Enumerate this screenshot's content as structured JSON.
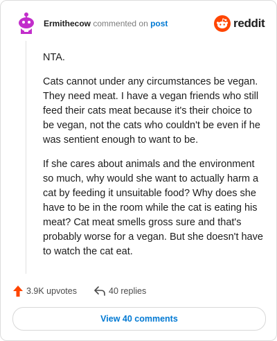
{
  "comment": {
    "username": "Ermithecow",
    "action_text": "commented on",
    "target_link": "post",
    "paragraphs": [
      "NTA.",
      "Cats cannot under any circumstances be vegan. They need meat. I have a vegan friends who still feed their cats meat because it's their choice to be vegan, not the cats who couldn't be even if he was sentient enough to want to be.",
      "If she cares about animals and the environment so much, why would she want to actually harm a cat by feeding it unsuitable food? Why does she have to be in the room while the cat is eating his meat? Cat meat smells gross sure and that's probably worse for a vegan. But she doesn't have to watch the cat eat."
    ]
  },
  "brand": {
    "wordmark": "reddit",
    "icon": "reddit-snoo-icon",
    "color": "#ff4500"
  },
  "avatar": {
    "icon": "snoo-avatar-icon",
    "color": "#c22ecb"
  },
  "footer": {
    "upvotes_label": "3.9K upvotes",
    "replies_label": "40 replies",
    "view_button_label": "View 40 comments"
  },
  "colors": {
    "upvote": "#ff4500",
    "link": "#0079d3"
  }
}
